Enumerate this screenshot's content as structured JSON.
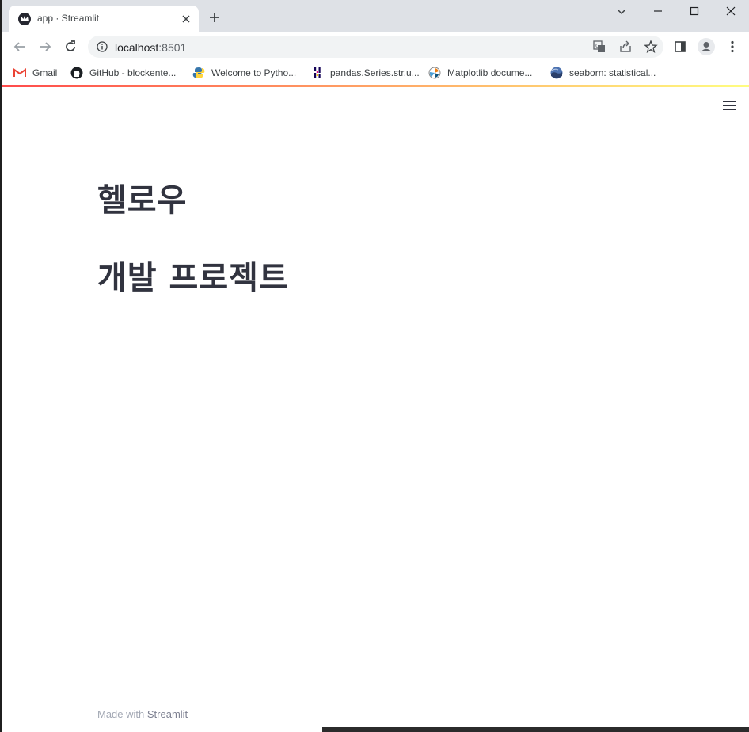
{
  "browser": {
    "tab_title": "app · Streamlit",
    "url_host": "localhost",
    "url_port": ":8501"
  },
  "bookmarks": [
    {
      "label": "Gmail",
      "icon": "gmail-icon"
    },
    {
      "label": "GitHub - blockente...",
      "icon": "github-icon"
    },
    {
      "label": "Welcome to Pytho...",
      "icon": "python-icon"
    },
    {
      "label": "pandas.Series.str.u...",
      "icon": "pandas-icon"
    },
    {
      "label": "Matplotlib docume...",
      "icon": "matplotlib-icon"
    },
    {
      "label": "seaborn: statistical...",
      "icon": "seaborn-icon"
    }
  ],
  "app": {
    "heading_1": "헬로우",
    "heading_2": "개발 프로젝트",
    "footer_prefix": "Made with ",
    "footer_brand": "Streamlit"
  },
  "colors": {
    "accent": "#ff4b4b",
    "text": "#31333f"
  }
}
